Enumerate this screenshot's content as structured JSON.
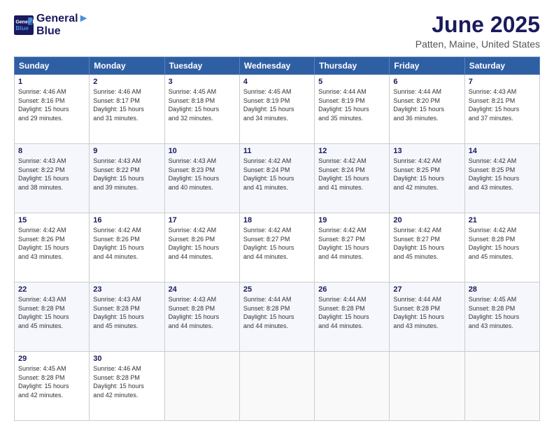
{
  "header": {
    "logo": {
      "line1": "General",
      "line2": "Blue"
    },
    "title": "June 2025",
    "subtitle": "Patten, Maine, United States"
  },
  "columns": [
    "Sunday",
    "Monday",
    "Tuesday",
    "Wednesday",
    "Thursday",
    "Friday",
    "Saturday"
  ],
  "weeks": [
    [
      {
        "day": "1",
        "sunrise": "4:46 AM",
        "sunset": "8:16 PM",
        "daylight": "15 hours and 29 minutes."
      },
      {
        "day": "2",
        "sunrise": "4:46 AM",
        "sunset": "8:17 PM",
        "daylight": "15 hours and 31 minutes."
      },
      {
        "day": "3",
        "sunrise": "4:45 AM",
        "sunset": "8:18 PM",
        "daylight": "15 hours and 32 minutes."
      },
      {
        "day": "4",
        "sunrise": "4:45 AM",
        "sunset": "8:19 PM",
        "daylight": "15 hours and 34 minutes."
      },
      {
        "day": "5",
        "sunrise": "4:44 AM",
        "sunset": "8:19 PM",
        "daylight": "15 hours and 35 minutes."
      },
      {
        "day": "6",
        "sunrise": "4:44 AM",
        "sunset": "8:20 PM",
        "daylight": "15 hours and 36 minutes."
      },
      {
        "day": "7",
        "sunrise": "4:43 AM",
        "sunset": "8:21 PM",
        "daylight": "15 hours and 37 minutes."
      }
    ],
    [
      {
        "day": "8",
        "sunrise": "4:43 AM",
        "sunset": "8:22 PM",
        "daylight": "15 hours and 38 minutes."
      },
      {
        "day": "9",
        "sunrise": "4:43 AM",
        "sunset": "8:22 PM",
        "daylight": "15 hours and 39 minutes."
      },
      {
        "day": "10",
        "sunrise": "4:43 AM",
        "sunset": "8:23 PM",
        "daylight": "15 hours and 40 minutes."
      },
      {
        "day": "11",
        "sunrise": "4:42 AM",
        "sunset": "8:24 PM",
        "daylight": "15 hours and 41 minutes."
      },
      {
        "day": "12",
        "sunrise": "4:42 AM",
        "sunset": "8:24 PM",
        "daylight": "15 hours and 41 minutes."
      },
      {
        "day": "13",
        "sunrise": "4:42 AM",
        "sunset": "8:25 PM",
        "daylight": "15 hours and 42 minutes."
      },
      {
        "day": "14",
        "sunrise": "4:42 AM",
        "sunset": "8:25 PM",
        "daylight": "15 hours and 43 minutes."
      }
    ],
    [
      {
        "day": "15",
        "sunrise": "4:42 AM",
        "sunset": "8:26 PM",
        "daylight": "15 hours and 43 minutes."
      },
      {
        "day": "16",
        "sunrise": "4:42 AM",
        "sunset": "8:26 PM",
        "daylight": "15 hours and 44 minutes."
      },
      {
        "day": "17",
        "sunrise": "4:42 AM",
        "sunset": "8:26 PM",
        "daylight": "15 hours and 44 minutes."
      },
      {
        "day": "18",
        "sunrise": "4:42 AM",
        "sunset": "8:27 PM",
        "daylight": "15 hours and 44 minutes."
      },
      {
        "day": "19",
        "sunrise": "4:42 AM",
        "sunset": "8:27 PM",
        "daylight": "15 hours and 44 minutes."
      },
      {
        "day": "20",
        "sunrise": "4:42 AM",
        "sunset": "8:27 PM",
        "daylight": "15 hours and 45 minutes."
      },
      {
        "day": "21",
        "sunrise": "4:42 AM",
        "sunset": "8:28 PM",
        "daylight": "15 hours and 45 minutes."
      }
    ],
    [
      {
        "day": "22",
        "sunrise": "4:43 AM",
        "sunset": "8:28 PM",
        "daylight": "15 hours and 45 minutes."
      },
      {
        "day": "23",
        "sunrise": "4:43 AM",
        "sunset": "8:28 PM",
        "daylight": "15 hours and 45 minutes."
      },
      {
        "day": "24",
        "sunrise": "4:43 AM",
        "sunset": "8:28 PM",
        "daylight": "15 hours and 44 minutes."
      },
      {
        "day": "25",
        "sunrise": "4:44 AM",
        "sunset": "8:28 PM",
        "daylight": "15 hours and 44 minutes."
      },
      {
        "day": "26",
        "sunrise": "4:44 AM",
        "sunset": "8:28 PM",
        "daylight": "15 hours and 44 minutes."
      },
      {
        "day": "27",
        "sunrise": "4:44 AM",
        "sunset": "8:28 PM",
        "daylight": "15 hours and 43 minutes."
      },
      {
        "day": "28",
        "sunrise": "4:45 AM",
        "sunset": "8:28 PM",
        "daylight": "15 hours and 43 minutes."
      }
    ],
    [
      {
        "day": "29",
        "sunrise": "4:45 AM",
        "sunset": "8:28 PM",
        "daylight": "15 hours and 42 minutes."
      },
      {
        "day": "30",
        "sunrise": "4:46 AM",
        "sunset": "8:28 PM",
        "daylight": "15 hours and 42 minutes."
      },
      null,
      null,
      null,
      null,
      null
    ]
  ]
}
